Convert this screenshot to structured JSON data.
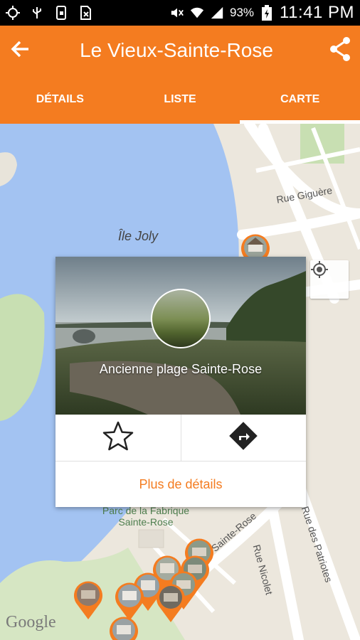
{
  "status_bar": {
    "battery_percent": "93%",
    "time": "11:41 PM",
    "icons": [
      "gps-icon",
      "usb-icon",
      "phone-icon",
      "sim-icon",
      "mute-icon",
      "wifi-icon",
      "signal-icon",
      "battery-icon"
    ]
  },
  "app_bar": {
    "title": "Le Vieux-Sainte-Rose",
    "back_icon": "arrow-left-icon",
    "share_icon": "share-icon"
  },
  "tabs": [
    {
      "label": "DÉTAILS",
      "active": false
    },
    {
      "label": "LISTE",
      "active": false
    },
    {
      "label": "CARTE",
      "active": true
    }
  ],
  "map": {
    "labels": {
      "island": "Île Joly",
      "street_giguere": "Rue Giguère",
      "park": "Parc de la Fabrique\nSainte-Rose",
      "sainte_rose": "Sainte-Rose",
      "rue_nicolet": "Rue Nicolet",
      "rue_patriotes": "Rue des Patriotes"
    },
    "attribution": "Google",
    "accent_color": "#f47c20"
  },
  "popup": {
    "place_name": "Ancienne plage Sainte-Rose",
    "favorite_icon": "star-outline-icon",
    "directions_icon": "directions-icon",
    "more_details": "Plus de détails"
  }
}
